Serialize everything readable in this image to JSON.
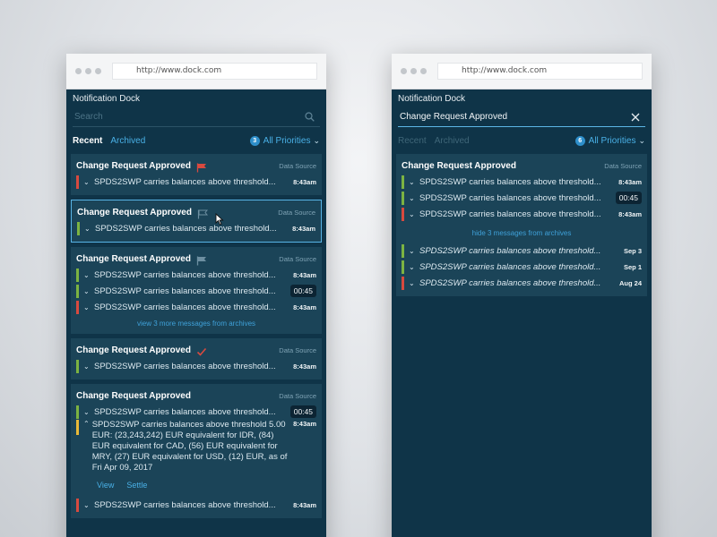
{
  "left": {
    "url": "http://www.dock.com",
    "dock_title": "Notification Dock",
    "search_placeholder": "Search",
    "tabs": {
      "recent": "Recent",
      "archived": "Archived"
    },
    "priority": {
      "count": "3",
      "label": "All Priorities"
    },
    "cards": [
      {
        "title": "Change Request Approved",
        "flag": "red",
        "source": "Data Source",
        "rows": [
          {
            "status": "red",
            "text": "SPDS2SWP carries balances above threshold...",
            "time": "8:43am"
          }
        ]
      },
      {
        "title": "Change Request Approved",
        "flag": "outline",
        "source": "Data Source",
        "rows": [
          {
            "status": "green",
            "text": "SPDS2SWP carries balances above threshold...",
            "time": "8:43am"
          }
        ]
      },
      {
        "title": "Change Request Approved",
        "flag": "gray",
        "source": "Data Source",
        "rows": [
          {
            "status": "green",
            "text": "SPDS2SWP carries balances above threshold...",
            "time": "8:43am"
          },
          {
            "status": "green",
            "text": "SPDS2SWP carries balances above threshold...",
            "time": "00:45"
          },
          {
            "status": "red",
            "text": "SPDS2SWP carries balances above threshold...",
            "time": "8:43am"
          }
        ],
        "more": "view 3 more messages from archives"
      },
      {
        "title": "Change Request Approved",
        "flag": "check",
        "source": "Data Source",
        "rows": [
          {
            "status": "green",
            "text": "SPDS2SWP carries balances above threshold...",
            "time": "8:43am"
          }
        ]
      },
      {
        "title": "Change Request Approved",
        "source": "Data Source",
        "rows": [
          {
            "status": "green",
            "text": "SPDS2SWP carries balances above threshold...",
            "time": "00:45"
          }
        ],
        "expanded": {
          "text": "SPDS2SWP carries balances above threshold 5.00 EUR: (23,243,242) EUR equivalent for IDR, (84) EUR equivalent for CAD, (56) EUR equivalent for MRY, (27) EUR equivalent for USD, (12) EUR, as of Fri Apr 09, 2017",
          "time": "8:43am",
          "actions": {
            "view": "View",
            "settle": "Settle"
          }
        },
        "last_row": {
          "status": "red",
          "text": "SPDS2SWP carries balances above threshold...",
          "time": "8:43am"
        }
      }
    ]
  },
  "right": {
    "url": "http://www.dock.com",
    "dock_title": "Notification Dock",
    "search_value": "Change Request Approved",
    "tabs": {
      "recent": "Recent",
      "archived": "Archived"
    },
    "priority": {
      "count": "6",
      "label": "All Priorities"
    },
    "card": {
      "title": "Change Request Approved",
      "source": "Data Source",
      "rows": [
        {
          "status": "green",
          "text": "SPDS2SWP carries balances above threshold...",
          "time": "8:43am"
        },
        {
          "status": "green",
          "text": "SPDS2SWP carries balances above threshold...",
          "time": "00:45"
        },
        {
          "status": "red",
          "text": "SPDS2SWP carries balances above threshold...",
          "time": "8:43am"
        }
      ],
      "hide": "hide 3 messages from archives",
      "archive_rows": [
        {
          "status": "green",
          "text": "SPDS2SWP carries balances above threshold...",
          "time": "Sep 3"
        },
        {
          "status": "green",
          "text": "SPDS2SWP carries balances above threshold...",
          "time": "Sep 1"
        },
        {
          "status": "red",
          "text": "SPDS2SWP carries balances above threshold...",
          "time": "Aug 24"
        }
      ]
    }
  },
  "colors": {
    "panel": "#0f3448",
    "card": "#1b4458",
    "accent": "#49b0e6",
    "green": "#7cb342",
    "red": "#d84a3f",
    "yellow": "#e8b938"
  }
}
